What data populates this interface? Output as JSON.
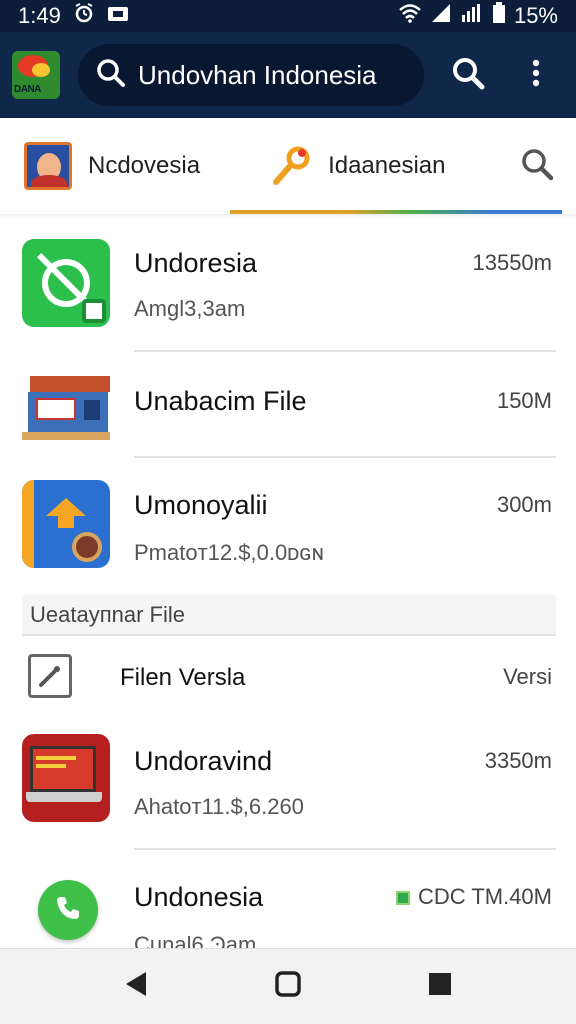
{
  "status_bar": {
    "time": "1:49",
    "battery": "15%"
  },
  "app_bar": {
    "logo_text": "DANA",
    "search_text": "Undovhan Indonesia"
  },
  "tabs": {
    "tab1_label": "Ncdovesia",
    "tab2_label": "Idaanesian"
  },
  "list": {
    "rows": [
      {
        "title": "Undoresia",
        "subtitle": "Amgl3,3am",
        "size": "13550m"
      },
      {
        "title": "Unabacim File",
        "subtitle": "",
        "size": "150M"
      },
      {
        "title": "Umonoyalii",
        "subtitle": "Pmatoт12.$,0.0ᴅɢɴ",
        "size": "300m"
      }
    ],
    "section_header": "Ueatayпnar File",
    "file_version": {
      "title": "Filen Versla",
      "value": "Versi"
    },
    "rows2": [
      {
        "title": "Undoravind",
        "subtitle": "Ahatoт11.$,6.260",
        "size": "3350m"
      },
      {
        "title": "Undonesia",
        "subtitle": "Cunal6 Ͽam",
        "size": "CDC TM.40M"
      }
    ]
  },
  "icons": {
    "search": "search-icon",
    "more": "more-vert-icon",
    "back": "back-icon",
    "home": "home-icon",
    "recents": "recents-icon"
  }
}
